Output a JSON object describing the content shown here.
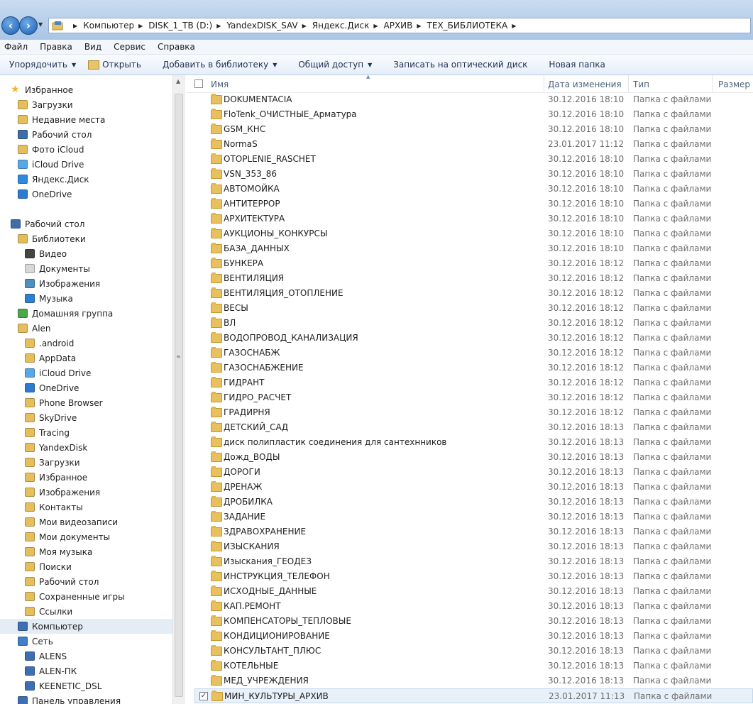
{
  "address": {
    "crumbs": [
      "Компьютер",
      "DISK_1_TB (D:)",
      "YandexDISK_SAV",
      "Яндекс.Диск",
      "АРХИВ",
      "ТЕХ_БИБЛИОТЕКА"
    ]
  },
  "menu": [
    "Файл",
    "Правка",
    "Вид",
    "Сервис",
    "Справка"
  ],
  "toolbar": {
    "organize": "Упорядочить",
    "open": "Открыть",
    "add_library": "Добавить в библиотеку",
    "share": "Общий доступ",
    "burn": "Записать на оптический диск",
    "new_folder": "Новая папка"
  },
  "columns": {
    "name": "Имя",
    "date": "Дата изменения",
    "type": "Тип",
    "size": "Размер"
  },
  "sidebar": [
    {
      "label": "Избранное",
      "icon": "star-icon",
      "level": 0
    },
    {
      "label": "Загрузки",
      "icon": "downloads-folder-icon",
      "level": 1
    },
    {
      "label": "Недавние места",
      "icon": "recent-places-icon",
      "level": 1
    },
    {
      "label": "Рабочий стол",
      "icon": "desktop-icon",
      "level": 1
    },
    {
      "label": "Фото iCloud",
      "icon": "icloud-photos-icon",
      "level": 1
    },
    {
      "label": "iCloud Drive",
      "icon": "icloud-icon",
      "level": 1
    },
    {
      "label": "Яндекс.Диск",
      "icon": "yandex-disk-icon",
      "level": 1
    },
    {
      "label": "OneDrive",
      "icon": "onedrive-icon",
      "level": 1
    },
    {
      "label": "Рабочий стол",
      "icon": "desktop-icon",
      "level": 0
    },
    {
      "label": "Библиотеки",
      "icon": "libraries-icon",
      "level": 1
    },
    {
      "label": "Видео",
      "icon": "video-library-icon",
      "level": 2
    },
    {
      "label": "Документы",
      "icon": "documents-library-icon",
      "level": 2
    },
    {
      "label": "Изображения",
      "icon": "pictures-library-icon",
      "level": 2
    },
    {
      "label": "Музыка",
      "icon": "music-library-icon",
      "level": 2
    },
    {
      "label": "Домашняя группа",
      "icon": "homegroup-icon",
      "level": 1
    },
    {
      "label": "Alen",
      "icon": "user-folder-icon",
      "level": 1
    },
    {
      "label": ".android",
      "icon": "folder-icon",
      "level": 2
    },
    {
      "label": "AppData",
      "icon": "folder-icon",
      "level": 2
    },
    {
      "label": "iCloud Drive",
      "icon": "icloud-icon",
      "level": 2
    },
    {
      "label": "OneDrive",
      "icon": "onedrive-icon",
      "level": 2
    },
    {
      "label": "Phone Browser",
      "icon": "folder-icon",
      "level": 2
    },
    {
      "label": "SkyDrive",
      "icon": "folder-icon",
      "level": 2
    },
    {
      "label": "Tracing",
      "icon": "folder-icon",
      "level": 2
    },
    {
      "label": "YandexDisk",
      "icon": "folder-icon",
      "level": 2
    },
    {
      "label": "Загрузки",
      "icon": "downloads-folder-icon",
      "level": 2
    },
    {
      "label": "Избранное",
      "icon": "favorites-folder-icon",
      "level": 2
    },
    {
      "label": "Изображения",
      "icon": "pictures-folder-icon",
      "level": 2
    },
    {
      "label": "Контакты",
      "icon": "contacts-folder-icon",
      "level": 2
    },
    {
      "label": "Мои видеозаписи",
      "icon": "videos-folder-icon",
      "level": 2
    },
    {
      "label": "Мои документы",
      "icon": "documents-folder-icon",
      "level": 2
    },
    {
      "label": "Моя музыка",
      "icon": "music-folder-icon",
      "level": 2
    },
    {
      "label": "Поиски",
      "icon": "searches-folder-icon",
      "level": 2
    },
    {
      "label": "Рабочий стол",
      "icon": "desktop-folder-icon",
      "level": 2
    },
    {
      "label": "Сохраненные игры",
      "icon": "saved-games-folder-icon",
      "level": 2
    },
    {
      "label": "Ссылки",
      "icon": "links-folder-icon",
      "level": 2
    },
    {
      "label": "Компьютер",
      "icon": "computer-icon",
      "level": 1,
      "selected": true
    },
    {
      "label": "Сеть",
      "icon": "network-icon",
      "level": 1
    },
    {
      "label": "ALENS",
      "icon": "network-computer-icon",
      "level": 2
    },
    {
      "label": "ALEN-ПК",
      "icon": "network-computer-icon",
      "level": 2
    },
    {
      "label": "KEENETIC_DSL",
      "icon": "network-computer-icon",
      "level": 2
    },
    {
      "label": "Панель управления",
      "icon": "control-panel-icon",
      "level": 1
    }
  ],
  "files": [
    {
      "name": "DOKUMENTACIA",
      "date": "30.12.2016 18:10",
      "type": "Папка с файлами"
    },
    {
      "name": "FloTenk_ОЧИСТНЫЕ_Арматура",
      "date": "30.12.2016 18:10",
      "type": "Папка с файлами"
    },
    {
      "name": "GSM_КНС",
      "date": "30.12.2016 18:10",
      "type": "Папка с файлами"
    },
    {
      "name": "NormaS",
      "date": "23.01.2017 11:12",
      "type": "Папка с файлами"
    },
    {
      "name": "OTOPLENIE_RASCHET",
      "date": "30.12.2016 18:10",
      "type": "Папка с файлами"
    },
    {
      "name": "VSN_353_86",
      "date": "30.12.2016 18:10",
      "type": "Папка с файлами"
    },
    {
      "name": "АВТОМОЙКА",
      "date": "30.12.2016 18:10",
      "type": "Папка с файлами"
    },
    {
      "name": "АНТИТЕРРОР",
      "date": "30.12.2016 18:10",
      "type": "Папка с файлами"
    },
    {
      "name": "АРХИТЕКТУРА",
      "date": "30.12.2016 18:10",
      "type": "Папка с файлами"
    },
    {
      "name": "АУКЦИОНЫ_КОНКУРСЫ",
      "date": "30.12.2016 18:10",
      "type": "Папка с файлами"
    },
    {
      "name": "БАЗА_ДАННЫХ",
      "date": "30.12.2016 18:10",
      "type": "Папка с файлами"
    },
    {
      "name": "БУНКЕРА",
      "date": "30.12.2016 18:12",
      "type": "Папка с файлами"
    },
    {
      "name": "ВЕНТИЛЯЦИЯ",
      "date": "30.12.2016 18:12",
      "type": "Папка с файлами"
    },
    {
      "name": "ВЕНТИЛЯЦИЯ_ОТОПЛЕНИЕ",
      "date": "30.12.2016 18:12",
      "type": "Папка с файлами"
    },
    {
      "name": "ВЕСЫ",
      "date": "30.12.2016 18:12",
      "type": "Папка с файлами"
    },
    {
      "name": "ВЛ",
      "date": "30.12.2016 18:12",
      "type": "Папка с файлами"
    },
    {
      "name": "ВОДОПРОВОД_КАНАЛИЗАЦИЯ",
      "date": "30.12.2016 18:12",
      "type": "Папка с файлами"
    },
    {
      "name": "ГАЗОСНАБЖ",
      "date": "30.12.2016 18:12",
      "type": "Папка с файлами"
    },
    {
      "name": "ГАЗОСНАБЖЕНИЕ",
      "date": "30.12.2016 18:12",
      "type": "Папка с файлами"
    },
    {
      "name": "ГИДРАНТ",
      "date": "30.12.2016 18:12",
      "type": "Папка с файлами"
    },
    {
      "name": "ГИДРО_РАСЧЕТ",
      "date": "30.12.2016 18:12",
      "type": "Папка с файлами"
    },
    {
      "name": "ГРАДИРНЯ",
      "date": "30.12.2016 18:12",
      "type": "Папка с файлами"
    },
    {
      "name": "ДЕТСКИЙ_САД",
      "date": "30.12.2016 18:13",
      "type": "Папка с файлами"
    },
    {
      "name": "диск полипластик соединения для сантехнников",
      "date": "30.12.2016 18:13",
      "type": "Папка с файлами"
    },
    {
      "name": "Дожд_ВОДЫ",
      "date": "30.12.2016 18:13",
      "type": "Папка с файлами"
    },
    {
      "name": "ДОРОГИ",
      "date": "30.12.2016 18:13",
      "type": "Папка с файлами"
    },
    {
      "name": "ДРЕНАЖ",
      "date": "30.12.2016 18:13",
      "type": "Папка с файлами"
    },
    {
      "name": "ДРОБИЛКА",
      "date": "30.12.2016 18:13",
      "type": "Папка с файлами"
    },
    {
      "name": "ЗАДАНИЕ",
      "date": "30.12.2016 18:13",
      "type": "Папка с файлами"
    },
    {
      "name": "ЗДРАВОХРАНЕНИЕ",
      "date": "30.12.2016 18:13",
      "type": "Папка с файлами"
    },
    {
      "name": "ИЗЫСКАНИЯ",
      "date": "30.12.2016 18:13",
      "type": "Папка с файлами"
    },
    {
      "name": "Изыскания_ГЕОДЕЗ",
      "date": "30.12.2016 18:13",
      "type": "Папка с файлами"
    },
    {
      "name": "ИНСТРУКЦИЯ_ТЕЛЕФОН",
      "date": "30.12.2016 18:13",
      "type": "Папка с файлами"
    },
    {
      "name": "ИСХОДНЫЕ_ДАННЫЕ",
      "date": "30.12.2016 18:13",
      "type": "Папка с файлами"
    },
    {
      "name": "КАП.РЕМОНТ",
      "date": "30.12.2016 18:13",
      "type": "Папка с файлами"
    },
    {
      "name": "КОМПЕНСАТОРЫ_ТЕПЛОВЫЕ",
      "date": "30.12.2016 18:13",
      "type": "Папка с файлами"
    },
    {
      "name": "КОНДИЦИОНИРОВАНИЕ",
      "date": "30.12.2016 18:13",
      "type": "Папка с файлами"
    },
    {
      "name": "КОНСУЛЬТАНТ_ПЛЮС",
      "date": "30.12.2016 18:13",
      "type": "Папка с файлами"
    },
    {
      "name": "КОТЕЛЬНЫЕ",
      "date": "30.12.2016 18:13",
      "type": "Папка с файлами"
    },
    {
      "name": "МЕД_УЧРЕЖДЕНИЯ",
      "date": "30.12.2016 18:13",
      "type": "Папка с файлами"
    },
    {
      "name": "МИН_КУЛЬТУРЫ_АРХИВ",
      "date": "23.01.2017 11:13",
      "type": "Папка с файлами",
      "selected": true,
      "checked": true
    }
  ]
}
